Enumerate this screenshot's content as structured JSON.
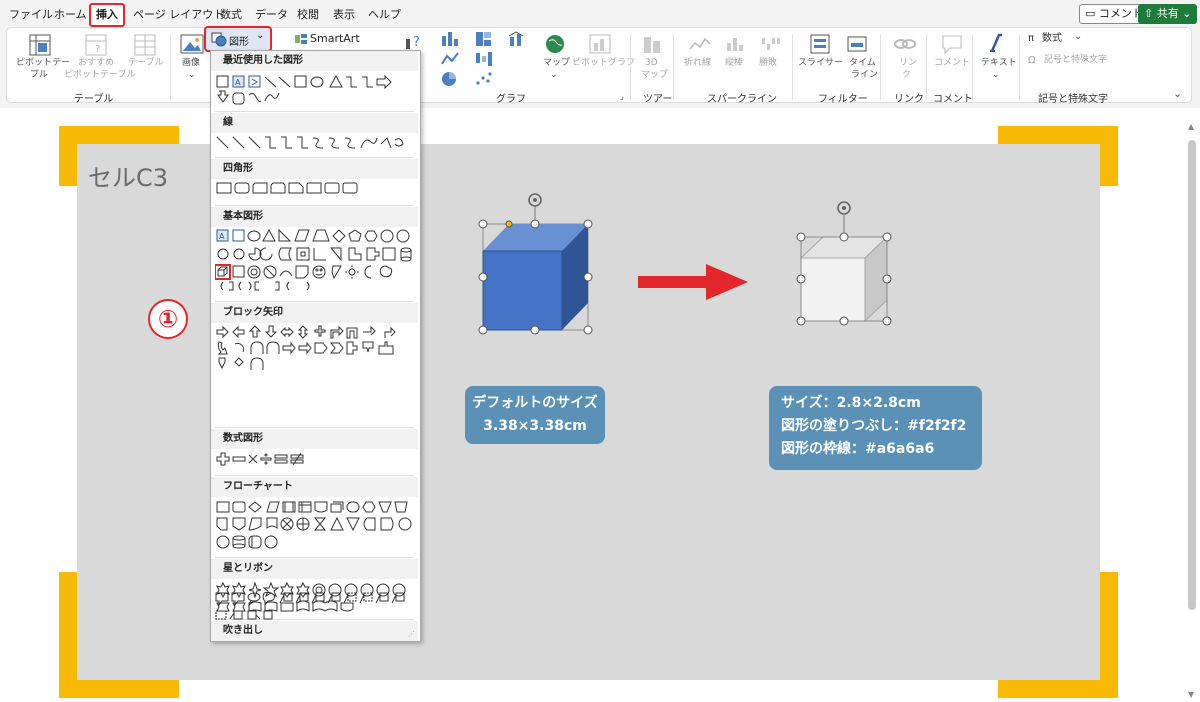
{
  "menu": {
    "items": [
      "ファイル",
      "ホーム",
      "挿入",
      "ページ レイアウト",
      "数式",
      "データ",
      "校閲",
      "表示",
      "ヘルプ"
    ],
    "active": "挿入",
    "comment_button": "コメント",
    "share_button": "共有"
  },
  "ribbon": {
    "pivot_table": [
      "ピボットテー",
      "ブル"
    ],
    "recommended_pivot": [
      "おすすめ",
      "ピボットテーブル"
    ],
    "table": "テーブル",
    "image": "画像",
    "shapes_button": "図形",
    "smartart": "SmartArt",
    "map": "マップ",
    "pivot_chart": "ピボットグラフ",
    "map3d": [
      "3D",
      "マップ"
    ],
    "line": "折れ線",
    "column": "縦棒",
    "winloss": "勝敗",
    "slicer": "スライサー",
    "timeline": [
      "タイム",
      "ライン"
    ],
    "link": [
      "リン",
      "ク"
    ],
    "comment": "コメント",
    "text": "テキスト",
    "equation": "数式",
    "symbol": "記号と特殊文字",
    "groups": {
      "table": "テーブル",
      "chart": "グラフ",
      "tour": "ツアー",
      "sparkline": "スパークライン",
      "filter": "フィルター",
      "link": "リンク",
      "comment": "コメント",
      "symbols": "記号と特殊文字"
    }
  },
  "dropdown": {
    "sections": [
      "最近使用した図形",
      "線",
      "四角形",
      "基本図形",
      "ブロック矢印",
      "数式図形",
      "フローチャート",
      "星とリボン",
      "吹き出し"
    ]
  },
  "canvas": {
    "cell_label": "セルC3",
    "step_number": "①",
    "default_box": [
      "デフォルトのサイズ",
      "3.38×3.38cm"
    ],
    "custom_box": [
      "サイズ：2.8×2.8cm",
      "図形の塗りつぶし：#f2f2f2",
      "図形の枠線：#a6a6a6"
    ]
  },
  "colors": {
    "accent_red": "#e3262b",
    "highlight_yellow": "#f9ba05",
    "cube_blue": "#4472c4",
    "cube_gray": "#f2f2f2",
    "cube_outline": "#a6a6a6",
    "info_box": "#5b91b6",
    "share_green": "#1e7b3c"
  }
}
